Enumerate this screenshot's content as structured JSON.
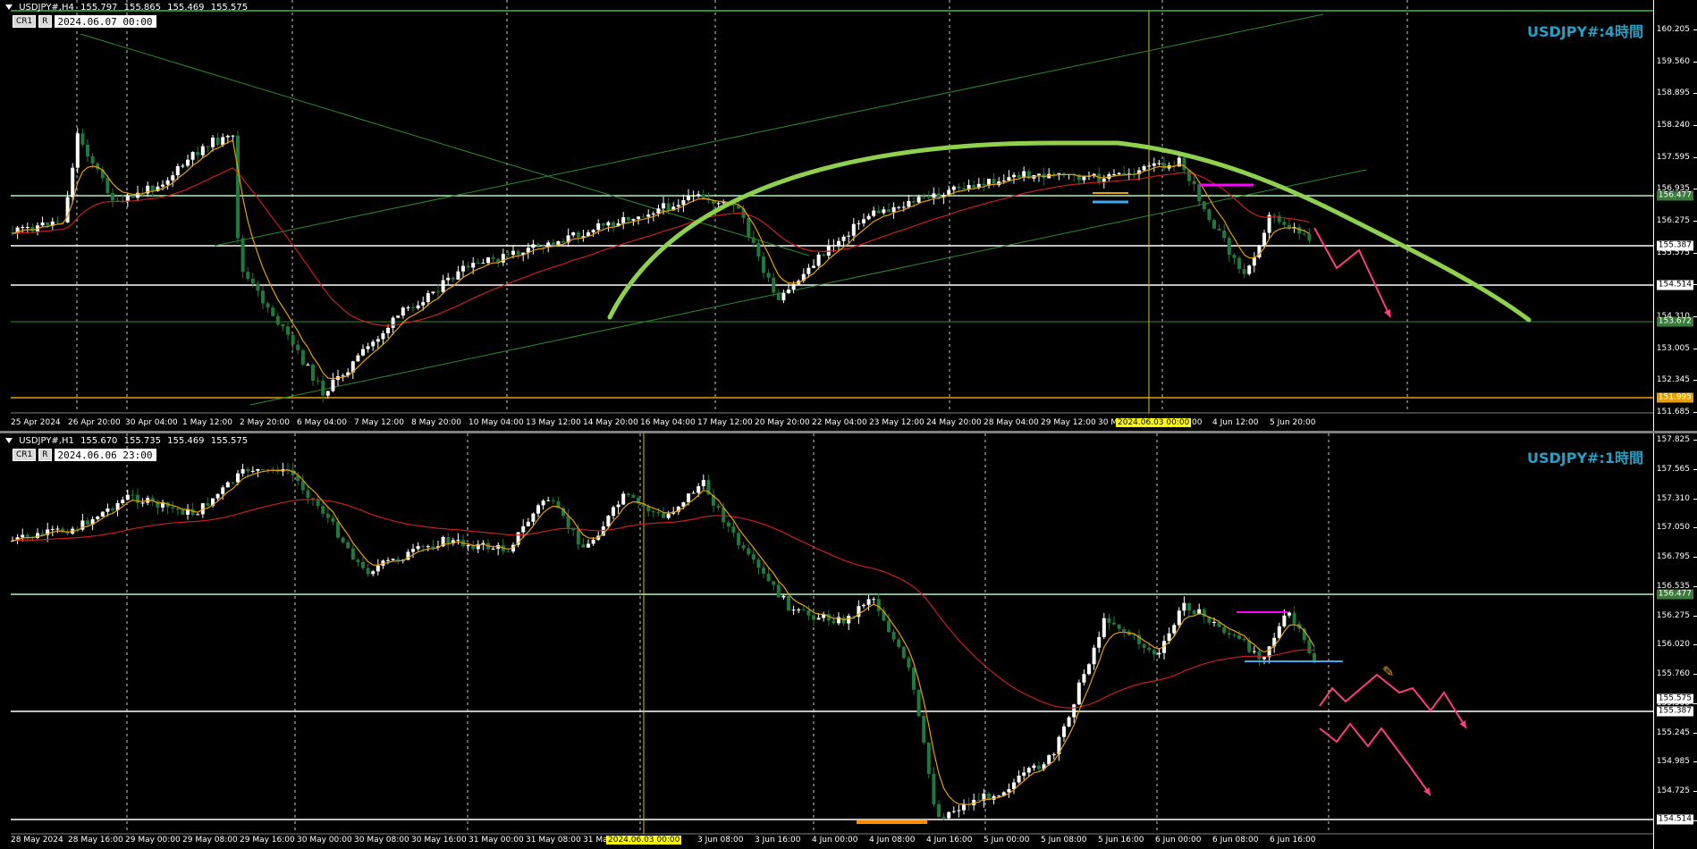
{
  "h4": {
    "header": {
      "symbol": "USDJPY#,H4",
      "open": "155.797",
      "high": "155.865",
      "low": "155.469",
      "close": "155.575"
    },
    "buttons": [
      "CR1",
      "R"
    ],
    "cursor_time": "2024.06.07 00:00",
    "title": "USDJPY#:4時間",
    "y_ticks": [
      "160.205",
      "159.560",
      "158.895",
      "158.240",
      "157.595",
      "156.935",
      "156.275",
      "155.575",
      "154.970",
      "154.310",
      "153.005",
      "152.345",
      "151.685"
    ],
    "price_tags": [
      {
        "text": "156.477",
        "color": "#3a7a3a"
      },
      {
        "text": "155.387",
        "color": "#ffffff"
      },
      {
        "text": "154.514",
        "color": "#ffffff"
      },
      {
        "text": "153.672",
        "color": "#3a7a3a"
      },
      {
        "text": "151.995",
        "color": "#e6a000"
      }
    ],
    "x_ticks": [
      "25 Apr 2024",
      "26 Apr 20:00",
      "30 Apr 04:00",
      "1 May 12:00",
      "2 May 20:00",
      "6 May 04:00",
      "7 May 12:00",
      "8 May 20:00",
      "10 May 04:00",
      "13 May 12:00",
      "14 May 20:00",
      "16 May 04:00",
      "17 May 12:00",
      "20 May 20:00",
      "22 May 04:00",
      "23 May 12:00",
      "24 May 20:00",
      "28 May 04:00",
      "29 May 12:00",
      "30 M",
      "4 Jun 12:00",
      "5 Jun 20:00"
    ],
    "x_highlight": "2024.06.03 00:00",
    "x_tail": ":00"
  },
  "h1": {
    "header": {
      "symbol": "USDJPY#,H1",
      "open": "155.670",
      "high": "155.735",
      "low": "155.469",
      "close": "155.575"
    },
    "buttons": [
      "CR1",
      "R"
    ],
    "cursor_time": "2024.06.06 23:00",
    "title": "USDJPY#:1時間",
    "y_ticks": [
      "157.825",
      "157.565",
      "157.310",
      "157.050",
      "156.795",
      "156.535",
      "156.275",
      "156.020",
      "155.760",
      "155.500",
      "155.245",
      "154.985",
      "154.725",
      "154.470"
    ],
    "price_tags": [
      {
        "text": "156.477",
        "color": "#3a7a3a"
      },
      {
        "text": "155.575",
        "color": "#ffffff"
      },
      {
        "text": "155.387",
        "color": "#ffffff"
      },
      {
        "text": "154.514",
        "color": "#ffffff"
      }
    ],
    "x_ticks": [
      "28 May 2024",
      "28 May 16:00",
      "29 May 00:00",
      "29 May 08:00",
      "29 May 16:00",
      "30 May 00:00",
      "30 May 08:00",
      "30 May 16:00",
      "31 May 00:00",
      "31 May 08:00",
      "31 Ma",
      "3 Jun 08:00",
      "3 Jun 16:00",
      "4 Jun 00:00",
      "4 Jun 08:00",
      "4 Jun 16:00",
      "5 Jun 00:00",
      "5 Jun 08:00",
      "5 Jun 16:00",
      "6 Jun 00:00",
      "6 Jun 08:00",
      "6 Jun 16:00"
    ],
    "x_highlight": "2024.06.03 00:00"
  },
  "colors": {
    "background": "#000000",
    "bull_candle": "#ffffff",
    "bear_candle": "#1e7a3c",
    "ma_slow": "#c81e1e",
    "ma_fast": "#e6a000",
    "arc": "#8fd14f",
    "forecast": "#ff3c7d",
    "title": "#26a0c5"
  }
}
